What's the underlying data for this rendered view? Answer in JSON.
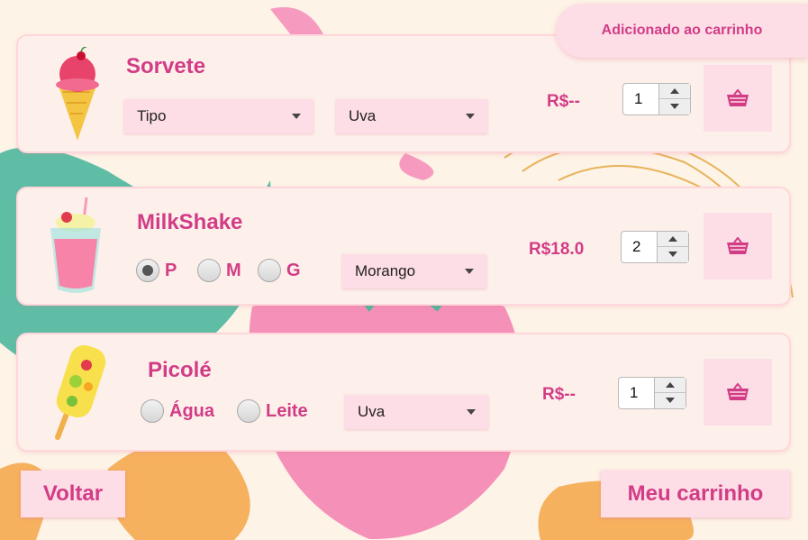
{
  "toast": "Adicionado ao carrinho",
  "products": [
    {
      "name": "Sorvete",
      "selects": [
        "Tipo",
        "Uva"
      ],
      "price": "R$--",
      "quantity": "1"
    },
    {
      "name": "MilkShake",
      "sizes": [
        "P",
        "M",
        "G"
      ],
      "selected_size": "P",
      "flavor": "Morango",
      "price": "R$18.0",
      "quantity": "2"
    },
    {
      "name": "Picolé",
      "bases": [
        "Água",
        "Leite"
      ],
      "flavor": "Uva",
      "price": "R$--",
      "quantity": "1"
    }
  ],
  "back_label": "Voltar",
  "cart_label": "Meu carrinho",
  "colors": {
    "accent": "#d23c86",
    "button_bg": "#fddde6",
    "card_bg": "#fdf0ea"
  },
  "icons": [
    "ice-cream-cone-icon",
    "milkshake-icon",
    "popsicle-icon",
    "basket-icon"
  ]
}
